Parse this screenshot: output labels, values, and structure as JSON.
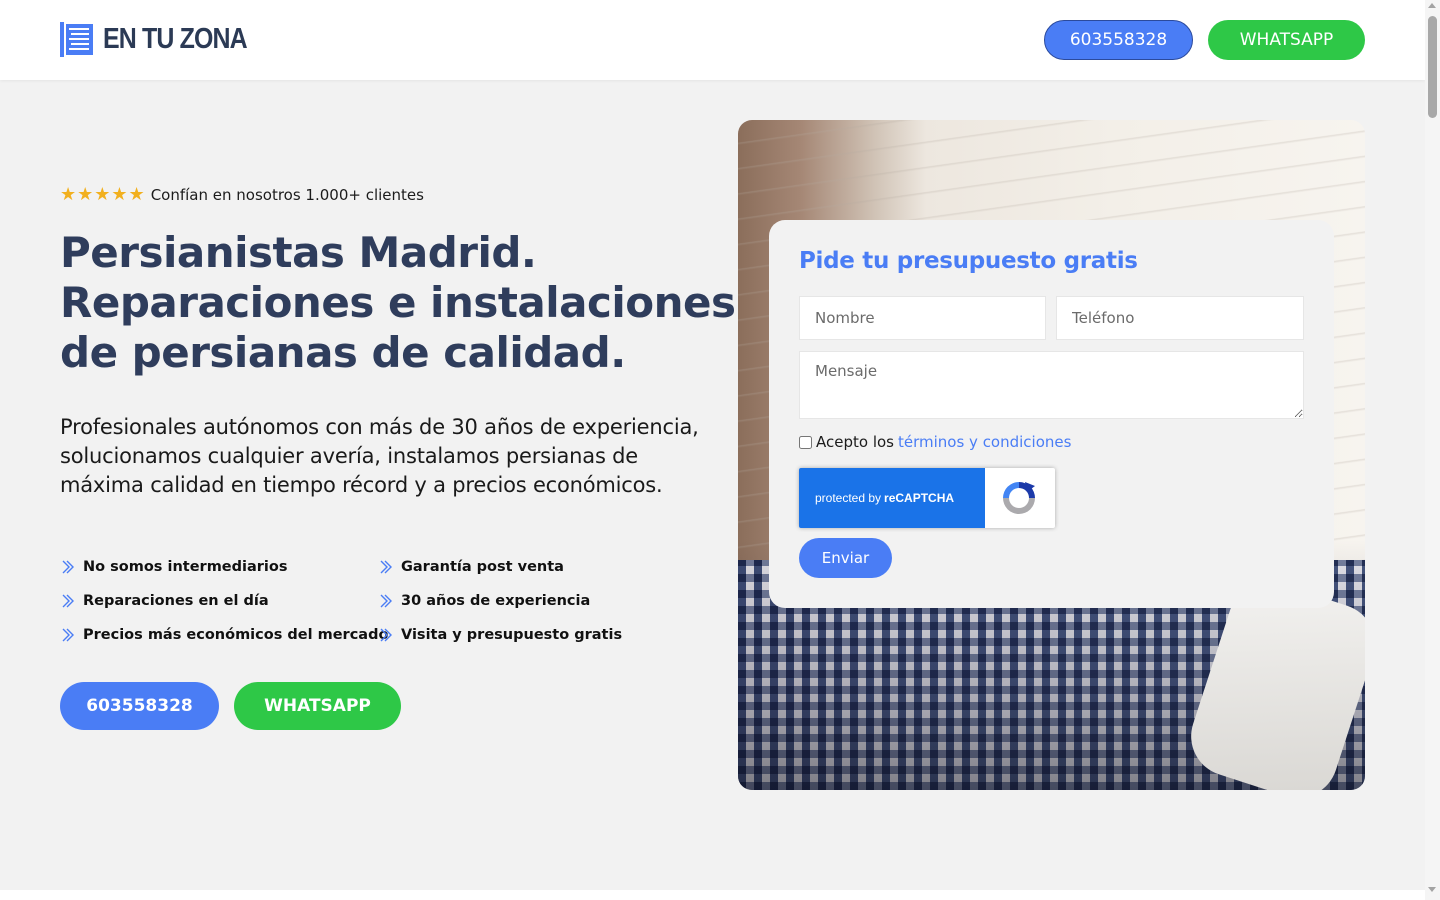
{
  "header": {
    "logo_text": "EN TU ZONA",
    "phone_button": "603558328",
    "whatsapp_button": "WHATSAPP"
  },
  "hero": {
    "stars": "★★★★★",
    "rating_text": "Confían en nosotros 1.000+ clientes",
    "title_lines": [
      "Persianistas Madrid.",
      "Reparaciones e instalaciones",
      "de persianas de calidad."
    ],
    "description": "Profesionales autónomos con más de 30 años de experiencia, solucionamos cualquier avería, instalamos persianas de máxima calidad en tiempo récord y a precios económicos.",
    "features": [
      "No somos intermediarios",
      "Garantía post venta",
      "Reparaciones en el día",
      "30 años de experiencia",
      "Precios más económicos del mercado",
      "Visita y presupuesto gratis"
    ],
    "cta_phone": "603558328",
    "cta_whatsapp": "WHATSAPP"
  },
  "form": {
    "title": "Pide tu presupuesto gratis",
    "name_placeholder": "Nombre",
    "phone_placeholder": "Teléfono",
    "message_placeholder": "Mensaje",
    "terms_prefix": "Acepto los",
    "terms_link": "términos y condiciones",
    "recaptcha_prefix": "protected by",
    "recaptcha_brand": "reCAPTCHA",
    "submit_label": "Enviar"
  },
  "colors": {
    "primary_blue": "#4a7df5",
    "whatsapp_green": "#2ec847",
    "title_navy": "#2f3d5c",
    "star_yellow": "#f2b01e"
  },
  "icons": {
    "logo": "blinds-logo-icon",
    "feature_bullet": "double-chevron-right-icon",
    "recaptcha": "recaptcha-icon"
  }
}
